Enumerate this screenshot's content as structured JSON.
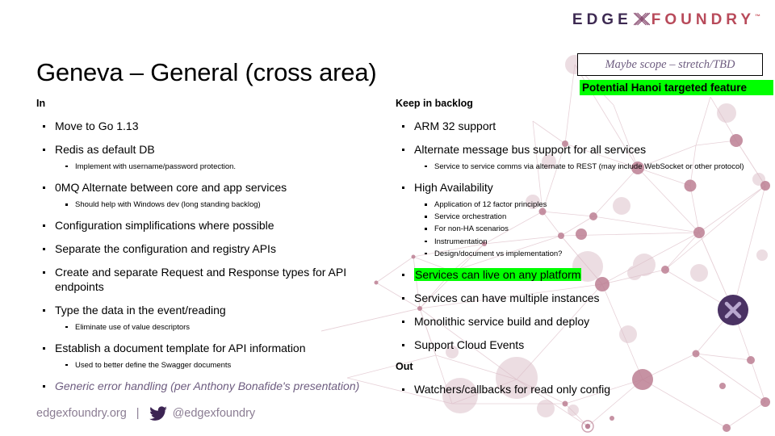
{
  "logo": {
    "part1": "EDGE",
    "x_glyph": "X",
    "part2": "FOUNDRY",
    "tm": "™",
    "icon": "edgex-x-logo"
  },
  "title": "Geneva – General (cross area)",
  "legend": {
    "maybe_scope": "Maybe scope – stretch/TBD",
    "hanoi_feature": "Potential Hanoi targeted feature",
    "maybe_scope_color": "#6e5d80",
    "hanoi_highlight_color": "#00ff00"
  },
  "left_column": {
    "heading": "In",
    "items": [
      {
        "level": 1,
        "text": "Move to Go 1.13"
      },
      {
        "level": 1,
        "text": "Redis as default DB"
      },
      {
        "level": 2,
        "text": "Implement with username/password protection."
      },
      {
        "level": 1,
        "text": "0MQ Alternate between core and app services"
      },
      {
        "level": 2,
        "text": "Should help with Windows dev (long standing backlog)"
      },
      {
        "level": 1,
        "text": "Configuration simplifications where possible"
      },
      {
        "level": 1,
        "text": "Separate the configuration and registry APIs"
      },
      {
        "level": 1,
        "text": "Create and separate Request and Response types for API endpoints"
      },
      {
        "level": 1,
        "text": "Type the data in the event/reading"
      },
      {
        "level": 2,
        "text": "Eliminate use of value descriptors"
      },
      {
        "level": 1,
        "text": "Establish a document template for API information"
      },
      {
        "level": 2,
        "text": "Used to better define the Swagger documents"
      },
      {
        "level": 1,
        "text": "Generic error handling (per Anthony Bonafide's presentation)",
        "style": "italic-purple"
      }
    ]
  },
  "right_column": {
    "heading": "Keep in backlog",
    "items": [
      {
        "level": 1,
        "text": "ARM 32 support"
      },
      {
        "level": 1,
        "text": "Alternate message bus support for all services"
      },
      {
        "level": 2,
        "text": "Service to service comms via alternate to REST (may include WebSocket or other protocol)"
      },
      {
        "level": 1,
        "text": "High Availability"
      },
      {
        "level": 2,
        "text": "Application of 12 factor principles"
      },
      {
        "level": 2,
        "text": "Service orchestration"
      },
      {
        "level": 2,
        "text": "For non-HA scenarios"
      },
      {
        "level": 2,
        "text": "Instrumentation"
      },
      {
        "level": 2,
        "text": "Design/document vs implementation?"
      },
      {
        "level": 1,
        "text": "Services can live on any platform",
        "style": "highlight-green"
      },
      {
        "level": 1,
        "text": "Services can have multiple instances"
      },
      {
        "level": 1,
        "text": "Monolithic service build and deploy"
      },
      {
        "level": 1,
        "text": "Support Cloud Events"
      }
    ],
    "heading2": "Out",
    "items2": [
      {
        "level": 1,
        "text": "Watchers/callbacks for read only config"
      }
    ]
  },
  "footer": {
    "website": "edgexfoundry.org",
    "separator": "|",
    "twitter_handle": "@edgexfoundry",
    "twitter_icon": "twitter-bird-icon"
  }
}
